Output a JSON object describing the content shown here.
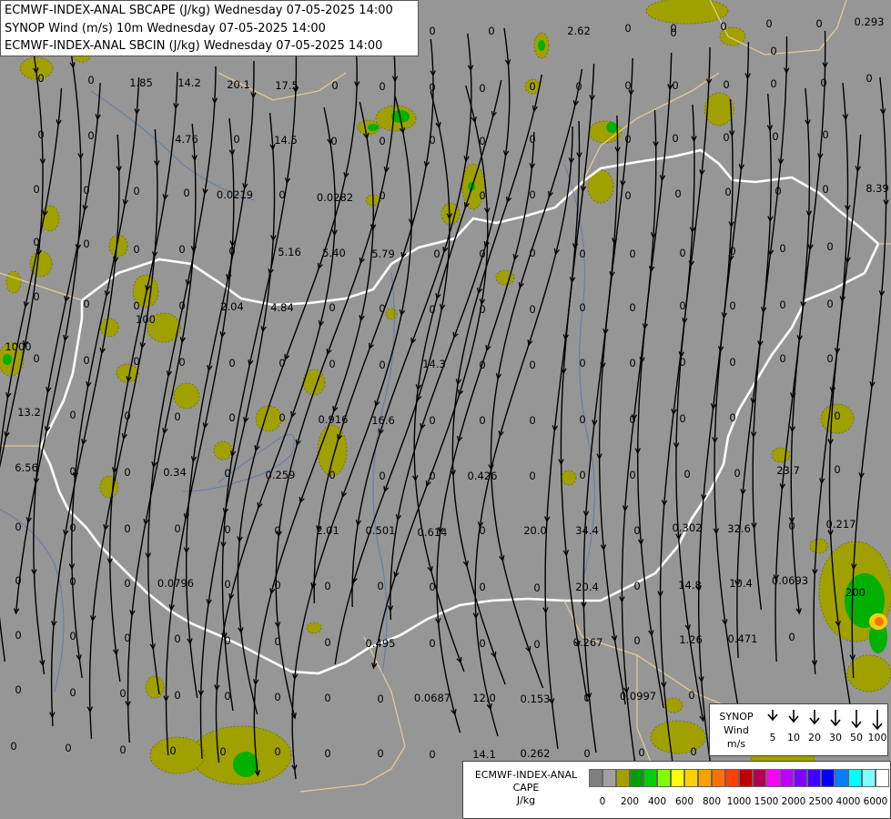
{
  "title": {
    "line1": "ECMWF-INDEX-ANAL SBCAPE (J/kg) Wednesday 07-05-2025 14:00",
    "line2": "SYNOP Wind (m/s) 10m Wednesday 07-05-2025 14:00",
    "line3": "ECMWF-INDEX-ANAL SBCIN (J/kg) Wednesday 07-05-2025 14:00"
  },
  "colors": {
    "background": "#969696",
    "cape_low": "#a0a000",
    "cape_green": "#00b000",
    "streamline": "#000000",
    "border_hungary": "#ffffff",
    "border_other": "#e6c896",
    "river": "#4b6eb4"
  },
  "synop_legend": {
    "label_line1": "SYNOP",
    "label_line2": "Wind",
    "label_line3": "m/s",
    "speeds": [
      "5",
      "10",
      "20",
      "30",
      "50",
      "100"
    ]
  },
  "cape_legend": {
    "label_line1": "ECMWF-INDEX-ANAL",
    "label_line2": "CAPE",
    "label_line3": "J/kg",
    "swatch_colors": [
      "#808080",
      "#a0a0a0",
      "#a0a000",
      "#00a000",
      "#00d000",
      "#80ff00",
      "#ffff00",
      "#ffd000",
      "#ffa000",
      "#ff7000",
      "#ff4000",
      "#c00000",
      "#b00050",
      "#ff00ff",
      "#c000ff",
      "#8000ff",
      "#4000ff",
      "#0000ff",
      "#0080ff",
      "#00ffff",
      "#80ffff",
      "#ffffff"
    ],
    "tick_labels": [
      "0",
      "200",
      "400",
      "600",
      "800",
      "1000",
      "1500",
      "2000",
      "2500",
      "4000",
      "6000"
    ]
  },
  "map_labels": [
    "0.293",
    "2.62",
    "1.85",
    "14.2",
    "20.1",
    "17.5",
    "4.76",
    "14.5",
    "8.39",
    "0.0219",
    "0.0282",
    "5.40",
    "5.79",
    "5.16",
    "2.04",
    "4.84",
    "14.3",
    "13.2",
    "0.916",
    "16.6",
    "6.56",
    "0.34",
    "0.259",
    "0.426",
    "23.7",
    "2.01",
    "0.501",
    "0.614",
    "20.0",
    "34.4",
    "0.302",
    "32.6",
    "0.217",
    "0.0796",
    "20.4",
    "14.8",
    "10.4",
    "0.0693",
    "0.495",
    "0.267",
    "1.26",
    "0.471",
    "0.0687",
    "12.0",
    "0.153",
    "0.0997",
    "14.1",
    "0.262",
    "100",
    "1000",
    "200"
  ]
}
